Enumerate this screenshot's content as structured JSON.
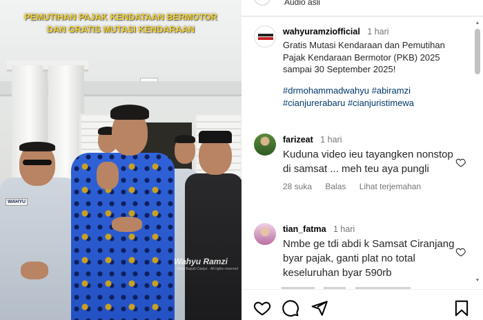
{
  "video": {
    "banner_line1": "PEMUTIHAN PAJAK KENDATAAN BERMOTOR",
    "banner_line2": "DAN GRATIS MUTASI KENDARAAN",
    "name_tag": "WAHYU",
    "watermark": "Wahyu Ramzi",
    "watermark_sub": "Wakil Bupati Cianjur · All rights reserved"
  },
  "top_strip": {
    "audio_label": "Audio asli"
  },
  "post": {
    "username": "wahyuramziofficial",
    "time": "1 hari",
    "avatar_label": "WAHYU RAMZI",
    "caption": "Gratis Mutasi Kendaraan dan Pemutihan Pajak Kendaraan Bermotor (PKB) 2025 sampai 30 September 2025!",
    "hashtags_line1": "#drmohammadwahyu #abiramzi",
    "hashtags_line2": "#cianjurerabaru #cianjuristimewa"
  },
  "comments": [
    {
      "username": "farizeat",
      "time": "1 hari",
      "text": "Kuduna video ieu tayangken nonstop di samsat ... meh teu aya pungli",
      "likes": "28 suka",
      "reply": "Balas",
      "translate": "Lihat terjemahan"
    },
    {
      "username": "tian_fatma",
      "time": "1 hari",
      "text": "Nmbe ge tdi abdi k Samsat Ciranjang byar pajak, ganti plat no total keseluruhan byar 590rb"
    }
  ],
  "icons": {
    "like": "heart-icon",
    "comment": "comment-icon",
    "share": "send-icon",
    "save": "bookmark-icon"
  },
  "colors": {
    "hashtag": "#00376b",
    "banner_text": "#f6d32b",
    "muted": "#737373"
  }
}
